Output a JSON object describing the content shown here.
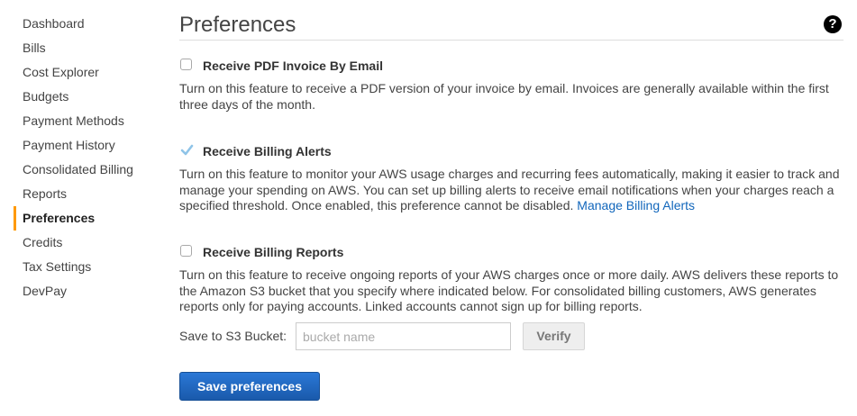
{
  "sidebar": {
    "items": [
      {
        "label": "Dashboard"
      },
      {
        "label": "Bills"
      },
      {
        "label": "Cost Explorer"
      },
      {
        "label": "Budgets"
      },
      {
        "label": "Payment Methods"
      },
      {
        "label": "Payment History"
      },
      {
        "label": "Consolidated Billing"
      },
      {
        "label": "Reports"
      },
      {
        "label": "Preferences",
        "active": true
      },
      {
        "label": "Credits"
      },
      {
        "label": "Tax Settings"
      },
      {
        "label": "DevPay"
      }
    ]
  },
  "header": {
    "title": "Preferences",
    "help_icon": "?"
  },
  "options": {
    "pdf_invoice": {
      "label": "Receive PDF Invoice By Email",
      "checked": false,
      "description": "Turn on this feature to receive a PDF version of your invoice by email. Invoices are generally available within the first three days of the month."
    },
    "billing_alerts": {
      "label": "Receive Billing Alerts",
      "checked": true,
      "description": "Turn on this feature to monitor your AWS usage charges and recurring fees automatically, making it easier to track and manage your spending on AWS. You can set up billing alerts to receive email notifications when your charges reach a specified threshold. Once enabled, this preference cannot be disabled.",
      "link_text": "Manage Billing Alerts"
    },
    "billing_reports": {
      "label": "Receive Billing Reports",
      "checked": false,
      "description": "Turn on this feature to receive ongoing reports of your AWS charges once or more daily. AWS delivers these reports to the Amazon S3 bucket that you specify where indicated below. For consolidated billing customers, AWS generates reports only for paying accounts. Linked accounts cannot sign up for billing reports."
    }
  },
  "bucket": {
    "label": "Save to S3 Bucket:",
    "value": "",
    "placeholder": "bucket name",
    "verify_label": "Verify"
  },
  "save_label": "Save preferences",
  "colors": {
    "accent": "#ff9900",
    "link": "#1166bb",
    "primary_button": "#1f66c1",
    "checkmark": "#8fc4e8"
  }
}
